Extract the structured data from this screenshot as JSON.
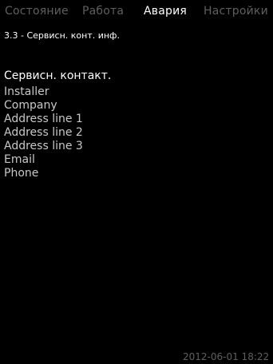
{
  "tabs": [
    {
      "label": "Состояние",
      "active": false
    },
    {
      "label": "Работа",
      "active": false
    },
    {
      "label": "Авария",
      "active": true
    },
    {
      "label": "Настройки",
      "active": false
    }
  ],
  "breadcrumb": "3.3 - Сервисн. конт. инф.",
  "menu": {
    "header": "Сервисн. контакт.",
    "items": [
      "Installer",
      "Company",
      "Address line 1",
      "Address line 2",
      "Address line 3",
      "Email",
      "Phone"
    ]
  },
  "status": {
    "datetime": "2012-06-01 18:22"
  },
  "colors": {
    "background": "#000000",
    "active_text": "#ffffff",
    "inactive_tab": "#5f5f5f",
    "menu_item": "#c8c8c8"
  }
}
